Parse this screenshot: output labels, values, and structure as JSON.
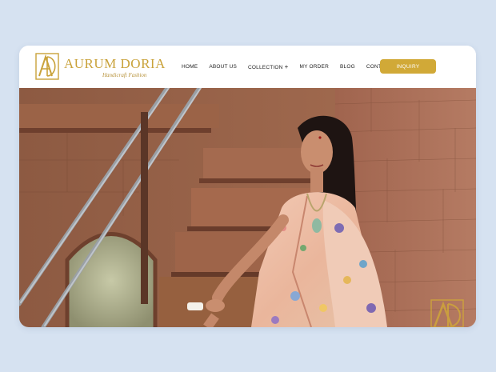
{
  "brand": {
    "name": "AURUM DORIA",
    "tagline": "Handicraft Fashion"
  },
  "nav": {
    "items": [
      {
        "label": "HOME"
      },
      {
        "label": "ABOUT US"
      },
      {
        "label": "COLLECTION",
        "has_submenu": true,
        "submenu_glyph": "+"
      },
      {
        "label": "MY ORDER"
      },
      {
        "label": "BLOG"
      },
      {
        "label": "CONTACT US"
      }
    ],
    "cta_label": "INQUIRY"
  },
  "colors": {
    "page_background": "#d6e2f1",
    "gold_accent": "#d1a937",
    "nav_text": "#222222"
  },
  "hero": {
    "image_subject": "woman in pastel floral saree seated on sandstone stairs",
    "watermark_icon": "ad-monogram-icon"
  }
}
